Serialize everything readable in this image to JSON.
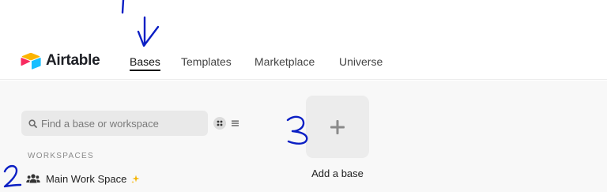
{
  "app": {
    "name": "Airtable",
    "brand_colors": [
      "#fcb400",
      "#18bfff",
      "#f82b60"
    ]
  },
  "nav": {
    "tabs": [
      {
        "label": "Bases",
        "active": true
      },
      {
        "label": "Templates",
        "active": false
      },
      {
        "label": "Marketplace",
        "active": false
      },
      {
        "label": "Universe",
        "active": false
      }
    ]
  },
  "search": {
    "placeholder": "Find a base or workspace",
    "value": "",
    "icon": "search-icon"
  },
  "view_toggle": {
    "grid_icon": "grid-view-icon",
    "list_icon": "list-view-icon"
  },
  "workspaces": {
    "section_label": "WORKSPACES",
    "items": [
      {
        "name": "Main Work Space",
        "icon": "users-icon",
        "badge_icon": "sparkle-icon",
        "badge_color": "#f5b400"
      }
    ]
  },
  "add_base": {
    "label": "Add a base",
    "icon": "plus-icon"
  },
  "annotations": {
    "marks": [
      "1",
      "2",
      "3"
    ],
    "ink_color": "#0b1fc4"
  }
}
